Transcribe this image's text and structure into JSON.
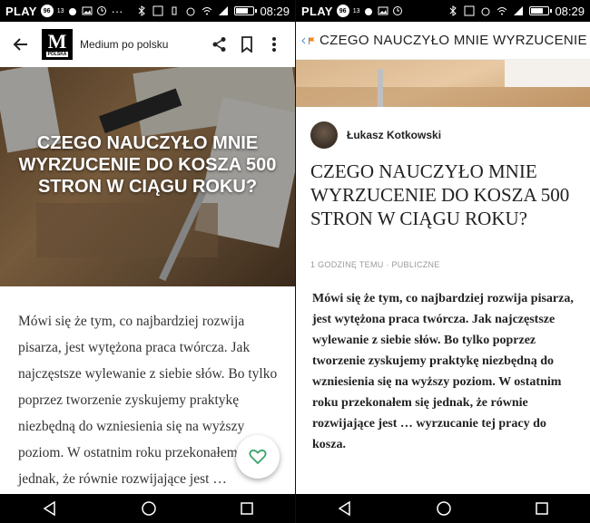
{
  "status_bar": {
    "carrier": "PLAY",
    "carrier_badge": "96",
    "signal_tag": "13",
    "time": "08:29",
    "battery_level": 0.75
  },
  "left": {
    "publication_name": "Medium po polsku",
    "logo_letter": "M",
    "logo_subtitle": "POLSKA",
    "article_title": "CZEGO NAUCZYŁO MNIE WYRZUCENIE DO KOSZA 500 STRON W CIĄGU ROKU?",
    "body": "Mówi się że tym, co najbardziej rozwija pisarza, jest wytężona praca twórcza. Jak najczęstsze wylewanie z siebie słów. Bo tylko poprzez tworzenie zyskujemy praktykę niezbędną do wzniesienia się na wyższy poziom. W ostatnim roku przekonałem się jednak, że równie rozwijające jest … wyrzucanie tej pracy do"
  },
  "right": {
    "header_title": "CZEGO NAUCZYŁO MNIE WYRZUCENIE DO KOSZA 500 STRON W CIĄGU ROKU?",
    "author": "Łukasz Kotkowski",
    "article_title": "CZEGO NAUCZYŁO MNIE WYRZUCENIE DO KOSZA 500 STRON W CIĄGU ROKU?",
    "meta": "1 GODZINĘ TEMU · PUBLICZNE",
    "body": "Mówi się że tym, co najbardziej rozwija pisarza, jest wytężona praca twórcza. Jak najczęstsze wylewanie z siebie słów. Bo tylko poprzez tworzenie zyskujemy praktykę niezbędną do wzniesienia się na wyższy poziom. W ostatnim roku przekonałem się jednak, że równie rozwijające jest … wyrzucanie tej pracy do kosza."
  },
  "colors": {
    "accent_green": "#3aa56b",
    "flag_orange": "#f08a24",
    "back_blue": "#4a8fd8"
  },
  "icons": [
    "back-arrow-icon",
    "share-icon",
    "bookmark-icon",
    "more-vert-icon",
    "heart-icon",
    "back-chevron-icon",
    "flag-icon",
    "nav-back-icon",
    "nav-home-icon",
    "nav-recents-icon"
  ]
}
